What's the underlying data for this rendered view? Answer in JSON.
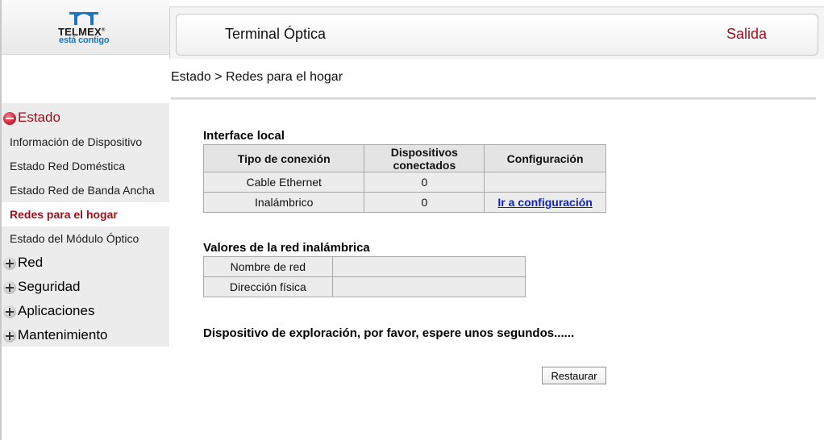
{
  "logo": {
    "brand": "TELMEX",
    "tagline": "está contigo",
    "icon": "telmex-logo-icon"
  },
  "header": {
    "title": "Terminal Óptica",
    "exit_label": "Salida"
  },
  "breadcrumb": "Estado > Redes para el hogar",
  "sidebar": {
    "groups": [
      {
        "label": "Estado",
        "expanded": true,
        "icon": "minus-circle-icon"
      },
      {
        "label": "Red",
        "expanded": false,
        "icon": "plus-circle-icon"
      },
      {
        "label": "Seguridad",
        "expanded": false,
        "icon": "plus-circle-icon"
      },
      {
        "label": "Aplicaciones",
        "expanded": false,
        "icon": "plus-circle-icon"
      },
      {
        "label": "Mantenimiento",
        "expanded": false,
        "icon": "plus-circle-icon"
      }
    ],
    "sub_items": [
      {
        "label": "Información de Dispositivo",
        "current": false
      },
      {
        "label": "Estado Red Doméstica",
        "current": false
      },
      {
        "label": "Estado Red de Banda Ancha",
        "current": false
      },
      {
        "label": "Redes para el hogar",
        "current": true
      },
      {
        "label": "Estado del Módulo Óptico",
        "current": false
      }
    ]
  },
  "local_interface": {
    "title": "Interface local",
    "headers": [
      "Tipo de conexión",
      "Dispositivos conectados",
      "Configuración"
    ],
    "rows": [
      {
        "type": "Cable Ethernet",
        "devices": "0",
        "config": ""
      },
      {
        "type": "Inalámbrico",
        "devices": "0",
        "config": "Ir a configuración"
      }
    ]
  },
  "wireless": {
    "title": "Valores de la red inalámbrica",
    "rows": [
      {
        "label": "Nombre de red",
        "value": ""
      },
      {
        "label": "Dirección física",
        "value": ""
      }
    ]
  },
  "scan_message": "Dispositivo de exploración, por favor, espere unos segundos......",
  "restore_label": "Restaurar",
  "colors": {
    "accent": "#9c0e1a",
    "link": "#0a1fd6",
    "logo_blue": "#1a76c2"
  }
}
